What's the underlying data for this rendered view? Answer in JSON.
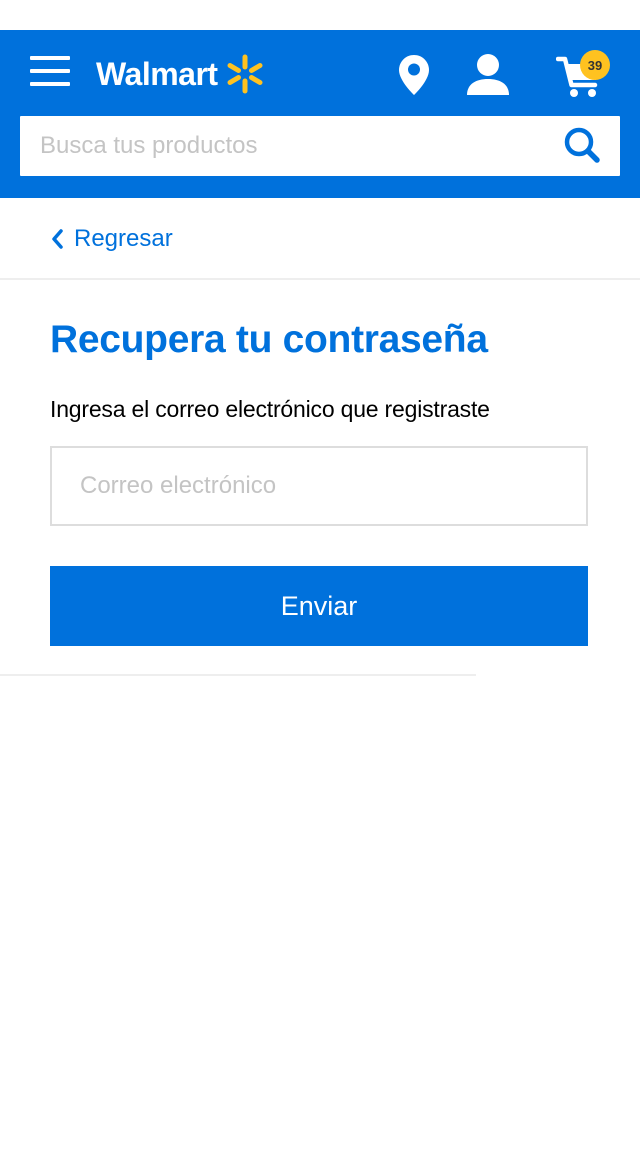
{
  "header": {
    "brand": "Walmart",
    "logo_icon": "walmart-spark-icon",
    "menu_icon": "hamburger-menu-icon",
    "location_icon": "location-pin-icon",
    "account_icon": "user-account-icon",
    "cart_icon": "shopping-cart-icon",
    "cart_count": "39",
    "colors": {
      "header_bg": "#0071dc",
      "spark": "#ffc220",
      "badge_bg": "#ffc220"
    }
  },
  "search": {
    "placeholder": "Busca tus productos",
    "value": "",
    "icon": "search-icon"
  },
  "nav": {
    "back_label": "Regresar",
    "back_icon": "chevron-left-icon"
  },
  "main": {
    "title": "Recupera tu contraseña",
    "subtitle": "Ingresa el correo electrónico que registraste",
    "email_placeholder": "Correo electrónico",
    "email_value": "",
    "submit_label": "Enviar",
    "colors": {
      "accent": "#0071dc",
      "field_border": "#dddddd"
    }
  }
}
